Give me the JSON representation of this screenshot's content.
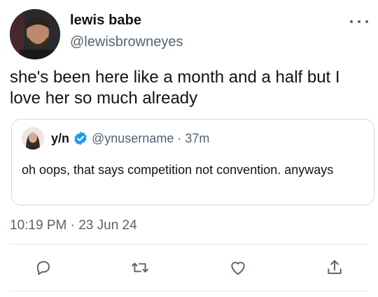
{
  "tweet": {
    "display_name": "lewis babe",
    "handle": "@lewisbrowneyes",
    "text": "she's been here like a month and a half but I love her so much already",
    "timestamp": "10:19 PM · 23 Jun 24"
  },
  "quoted_tweet": {
    "display_name": "y/n",
    "verified": true,
    "handle_and_time": "@ynusername · 37m",
    "text": "oh oops, that says competition not convention. anyways"
  },
  "actions": [
    {
      "icon": "reply-icon"
    },
    {
      "icon": "retweet-icon"
    },
    {
      "icon": "like-icon"
    },
    {
      "icon": "share-icon"
    }
  ],
  "colors": {
    "text_primary": "#0f1419",
    "text_secondary": "#536471",
    "border": "#cfd9de",
    "verified_blue": "#1d9bf0"
  }
}
